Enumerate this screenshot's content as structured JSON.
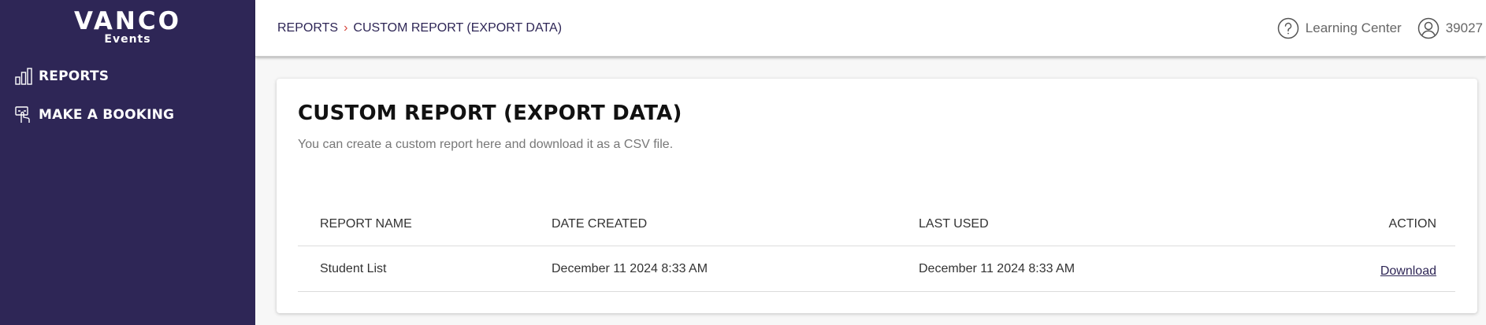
{
  "brand": {
    "name": "VANCO",
    "sub": "Events"
  },
  "sidebar": {
    "items": [
      {
        "label": "REPORTS",
        "icon": "bar-chart-icon"
      },
      {
        "label": "MAKE A BOOKING",
        "icon": "booking-hand-icon"
      }
    ]
  },
  "header": {
    "breadcrumb": [
      "REPORTS",
      "CUSTOM REPORT (EXPORT DATA)"
    ],
    "learning_center": "Learning Center",
    "user_id": "39027"
  },
  "main": {
    "title": "CUSTOM REPORT (EXPORT DATA)",
    "subtitle": "You can create a custom report here and download it as a CSV file.",
    "table": {
      "columns": [
        "REPORT NAME",
        "DATE CREATED",
        "LAST USED",
        "ACTION"
      ],
      "rows": [
        {
          "name": "Student List",
          "date_created": "December 11 2024 8:33 AM",
          "last_used": "December 11 2024 8:33 AM",
          "action": "Download"
        }
      ]
    }
  },
  "colors": {
    "sidebar_bg": "#2e2656",
    "breadcrumb_separator": "#d6453b",
    "link": "#2e2656"
  }
}
